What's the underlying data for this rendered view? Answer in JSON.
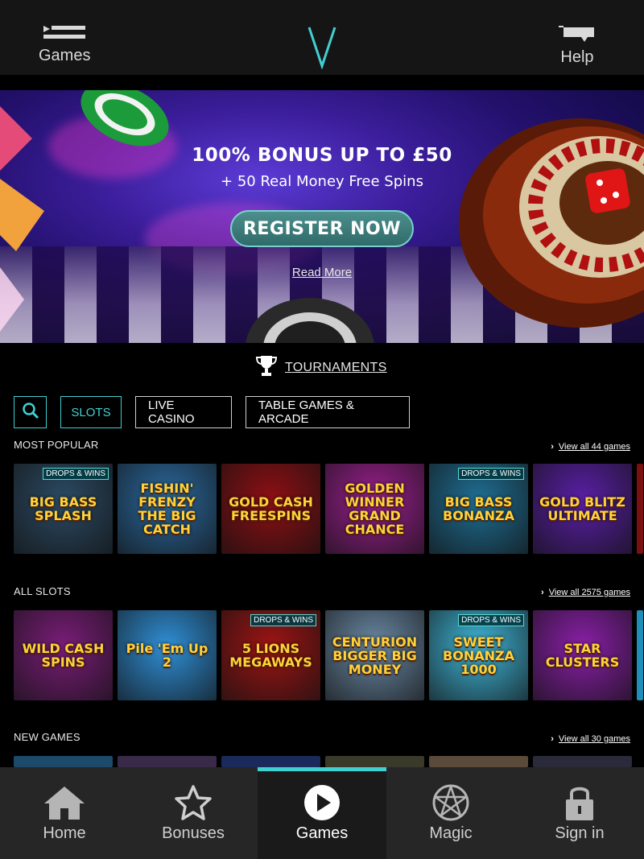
{
  "header": {
    "games_label": "Games",
    "help_label": "Help"
  },
  "banner": {
    "title": "100% BONUS UP TO £50",
    "subtitle": "+ 50 Real Money Free Spins",
    "register_label": "REGISTER NOW",
    "read_more_label": "Read More"
  },
  "tournaments": {
    "label": "TOURNAMENTS"
  },
  "filters": {
    "slots": "SLOTS",
    "live_casino": "LIVE CASINO",
    "table_games": "TABLE GAMES & ARCADE"
  },
  "sections": {
    "most_popular": {
      "title": "MOST POPULAR",
      "view_all": "View all 44 games",
      "games": [
        {
          "name": "BIG BASS SPLASH",
          "badge": "DROPS & WINS",
          "bg": "#2b4a63"
        },
        {
          "name": "FISHIN' FRENZY THE BIG CATCH",
          "badge": "",
          "bg": "#2b6aa0"
        },
        {
          "name": "GOLD CASH FREESPINS",
          "badge": "",
          "bg": "#8e0f14"
        },
        {
          "name": "GOLDEN WINNER GRAND CHANCE",
          "badge": "",
          "bg": "#9c1f8f"
        },
        {
          "name": "BIG BASS BONANZA",
          "badge": "DROPS & WINS",
          "bg": "#1f6e93"
        },
        {
          "name": "GOLD BLITZ ULTIMATE",
          "badge": "",
          "bg": "#5a1fa6"
        }
      ]
    },
    "all_slots": {
      "title": "ALL SLOTS",
      "view_all": "View all 2575 games",
      "games": [
        {
          "name": "WILD CASH SPINS",
          "badge": "",
          "bg": "#7a1d78"
        },
        {
          "name": "Pile 'Em Up 2",
          "badge": "",
          "bg": "#2f8fd6"
        },
        {
          "name": "5 LIONS MEGAWAYS",
          "badge": "DROPS & WINS",
          "bg": "#9e1414"
        },
        {
          "name": "CENTURION BIGGER BIG MONEY",
          "badge": "",
          "bg": "#6b8aa6"
        },
        {
          "name": "SWEET BONANZA 1000",
          "badge": "DROPS & WINS",
          "bg": "#3fb6d8"
        },
        {
          "name": "STAR CLUSTERS",
          "badge": "",
          "bg": "#8a1fa8"
        }
      ]
    },
    "new_games": {
      "title": "NEW GAMES",
      "view_all": "View all 30 games"
    }
  },
  "bottom_nav": {
    "home": "Home",
    "bonuses": "Bonuses",
    "games": "Games",
    "magic": "Magic",
    "sign_in": "Sign in"
  },
  "colors": {
    "accent": "#41d0d2",
    "header_bg": "#151515",
    "nav_bg": "#262626"
  }
}
